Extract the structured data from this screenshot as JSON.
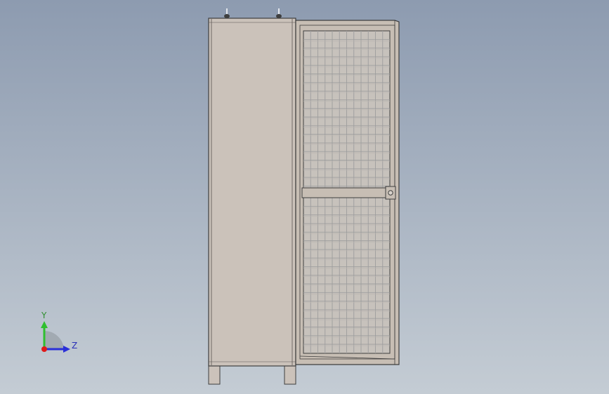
{
  "viewport": {
    "background_top": "#8d9bb0",
    "background_bottom": "#c4ccd4"
  },
  "model": {
    "body_color": "#cbc2ba",
    "frame_color": "#c7beb4",
    "edge_color": "#3e3e3e",
    "mesh_color": "#9e9e9e"
  },
  "triad": {
    "y_label": "Y",
    "z_label": "Z",
    "y_color": "#2fbf2f",
    "z_color": "#2a2fd8",
    "x_color": "#e01a1a"
  }
}
